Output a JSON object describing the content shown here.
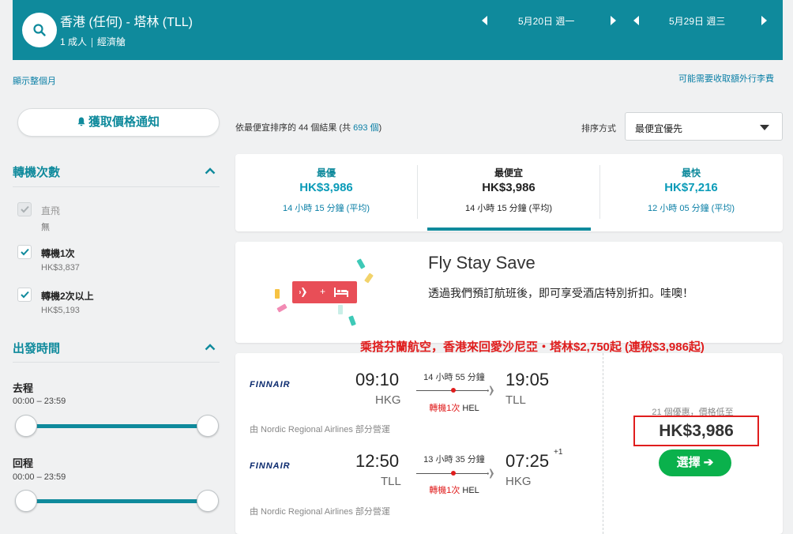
{
  "header": {
    "route": "香港 (任何) - 塔林 (TLL)",
    "passengers": "1 成人",
    "cabin": "經濟艙",
    "depart_date": "5月20日 週一",
    "return_date": "5月29日 週三",
    "icons": [
      "search-icon",
      "chevron-left-icon",
      "chevron-right-icon"
    ]
  },
  "links": {
    "show_month": "顯示整個月",
    "baggage": "可能需要收取額外行李費"
  },
  "sidebar": {
    "alert_button": "獲取價格通知",
    "stops_title": "轉機次數",
    "stops": [
      {
        "label": "直飛",
        "sub": "無",
        "checked": true,
        "disabled": true
      },
      {
        "label": "轉機1次",
        "sub": "HK$3,837",
        "checked": true,
        "disabled": false
      },
      {
        "label": "轉機2次以上",
        "sub": "HK$5,193",
        "checked": true,
        "disabled": false
      }
    ],
    "times_title": "出發時間",
    "outbound_label": "去程",
    "outbound_range": "00:00 – 23:59",
    "return_label": "回程",
    "return_range": "00:00 – 23:59"
  },
  "results": {
    "prefix": "依",
    "sort_word": "最便宜",
    "middle": "排序的 44 個結果 (共 ",
    "total": "693 個",
    "suffix": ")",
    "sort_label": "排序方式",
    "sort_value": "最便宜優先"
  },
  "tabs": [
    {
      "label": "最優",
      "price": "HK$3,986",
      "duration": "14 小時 15 分鐘 (平均)",
      "active": false
    },
    {
      "label": "最便宜",
      "price": "HK$3,986",
      "duration": "14 小時 15 分鐘 (平均)",
      "active": true
    },
    {
      "label": "最快",
      "price": "HK$7,216",
      "duration": "12 小時 05 分鐘 (平均)",
      "active": false
    }
  ],
  "promo": {
    "title": "Fly Stay Save",
    "description": "透過我們預訂航班後，即可享受酒店特別折扣。哇噢！",
    "badge_plus": "+"
  },
  "annotation": "乘搭芬蘭航空，香港來回愛沙尼亞・塔林$2,750起 (連稅$3,986起)",
  "flight": {
    "airline": "FINNAIR",
    "legs": [
      {
        "depart_time": "09:10",
        "depart_code": "HKG",
        "duration": "14 小時 55 分鐘",
        "stops": "轉機1次",
        "via": "HEL",
        "arrive_time": "19:05",
        "arrive_code": "TLL",
        "day_offset": "",
        "operated": "由 Nordic Regional Airlines 部分營運"
      },
      {
        "depart_time": "12:50",
        "depart_code": "TLL",
        "duration": "13 小時 35 分鐘",
        "stops": "轉機1次",
        "via": "HEL",
        "arrive_time": "07:25",
        "arrive_code": "HKG",
        "day_offset": "+1",
        "operated": "由 Nordic Regional Airlines 部分營運"
      }
    ],
    "deals": "21 個優惠，價格低至",
    "price": "HK$3,986",
    "select": "選擇 ➔"
  },
  "colors": {
    "brand_teal": "#0f8a9c",
    "highlight_red": "#e01d1d",
    "select_green": "#0ab14c"
  }
}
